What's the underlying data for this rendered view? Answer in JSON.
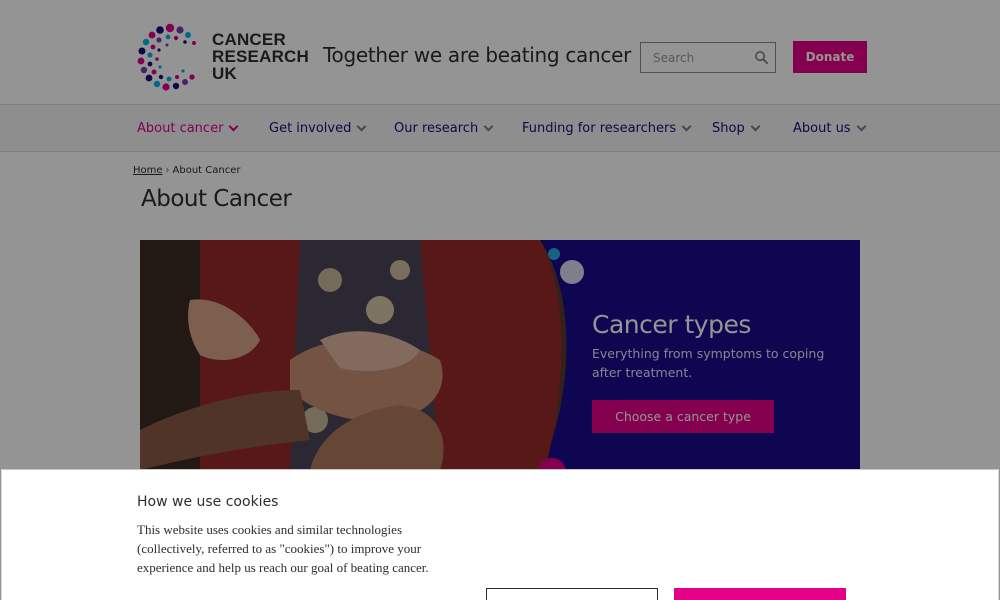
{
  "header": {
    "logo_lines": [
      "CANCER",
      "RESEARCH",
      "UK"
    ],
    "tagline": "Together we are beating cancer",
    "search_placeholder": "Search",
    "donate_label": "Donate"
  },
  "nav": {
    "items": [
      {
        "label": "About cancer",
        "active": true
      },
      {
        "label": "Get involved",
        "active": false
      },
      {
        "label": "Our research",
        "active": false
      },
      {
        "label": "Funding for researchers",
        "active": false
      },
      {
        "label": "Shop",
        "active": false
      },
      {
        "label": "About us",
        "active": false
      }
    ]
  },
  "breadcrumb": {
    "home": "Home",
    "separator": "›",
    "current": "About Cancer"
  },
  "page_title": "About Cancer",
  "hero": {
    "heading": "Cancer types",
    "description": "Everything from symptoms to coping after treatment.",
    "button_label": "Choose a cancer type"
  },
  "cookie_banner": {
    "title": "How we use cookies",
    "text": "This website uses cookies and similar technologies (collectively, referred to as \"cookies\") to improve your experience and help us reach our goal of beating cancer."
  },
  "colors": {
    "brand_pink": "#e40087",
    "brand_navy": "#1c0c83",
    "hero_blue": "#1a0b8c"
  },
  "icons": {
    "search": "search-icon",
    "nav_chevron": "chevron-down-icon"
  }
}
